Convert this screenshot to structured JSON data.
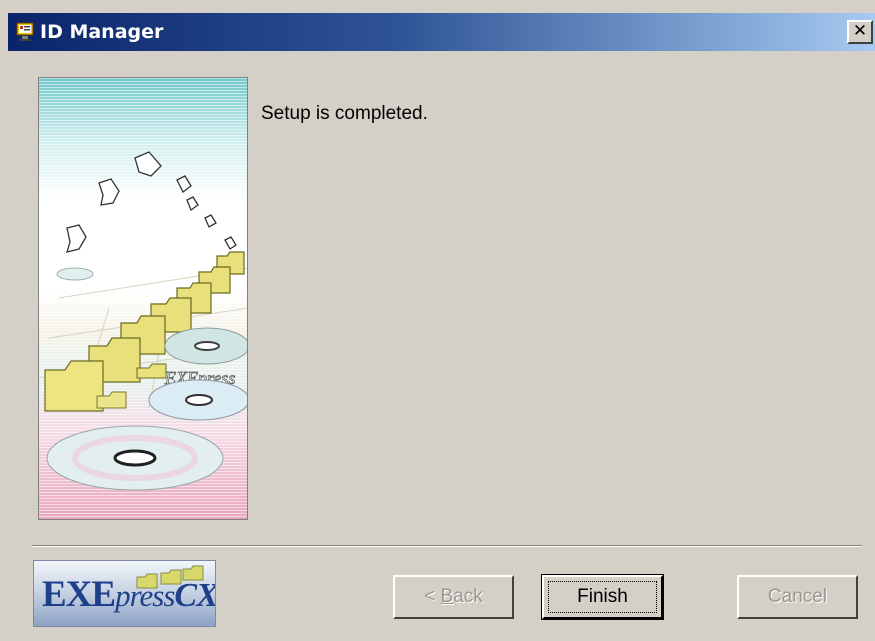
{
  "window": {
    "title": "ID Manager",
    "close_label": "✕",
    "titlebar_colors": [
      "#0a246a",
      "#a6caf0"
    ]
  },
  "main": {
    "message": "Setup is completed."
  },
  "side_panel": {
    "caption": "EXEpress"
  },
  "logo": {
    "part1": "EXE",
    "part2": "press",
    "part3": "CX"
  },
  "buttons": {
    "back_prefix": "< ",
    "back_mnemonic": "B",
    "back_rest": "ack",
    "back_enabled": false,
    "finish_label": "Finish",
    "finish_enabled": true,
    "cancel_label": "Cancel",
    "cancel_enabled": false
  },
  "icons": {
    "app": "id-manager-app-icon",
    "close": "close-icon"
  }
}
